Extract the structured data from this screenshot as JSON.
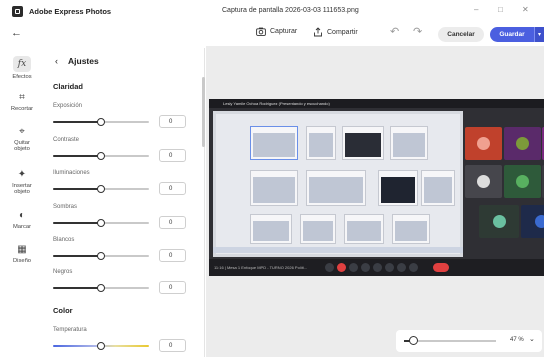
{
  "app": {
    "title": "Adobe Express Photos",
    "document_title": "Captura de pantalla 2026-03-03 111653.png"
  },
  "window_controls": {
    "minimize": "–",
    "maximize": "□",
    "close": "✕"
  },
  "toolbar": {
    "back_icon": "←",
    "capture_label": "Capturar",
    "share_label": "Compartir",
    "undo_icon": "↶",
    "redo_icon": "↷",
    "cancel_label": "Cancelar",
    "save_label": "Guardar",
    "save_more_icon": "▾"
  },
  "rail": {
    "items": [
      {
        "label": "Efectos",
        "icon": "fx"
      },
      {
        "label": "Recortar",
        "icon": "⌗"
      },
      {
        "label": "Quitar objeto",
        "icon": "⌖"
      },
      {
        "label": "Insertar objeto",
        "icon": "✦"
      },
      {
        "label": "Marcar",
        "icon": "◐"
      },
      {
        "label": "Diseño",
        "icon": "▦"
      }
    ]
  },
  "panel": {
    "back_icon": "‹",
    "title": "Ajustes",
    "sections": [
      {
        "title": "Claridad",
        "controls": [
          {
            "label": "Exposición",
            "value": "0",
            "level": 0.5
          },
          {
            "label": "Contraste",
            "value": "0",
            "level": 0.5
          },
          {
            "label": "Iluminaciones",
            "value": "0",
            "level": 0.5
          },
          {
            "label": "Sombras",
            "value": "0",
            "level": 0.5
          },
          {
            "label": "Blancos",
            "value": "0",
            "level": 0.5
          },
          {
            "label": "Negros",
            "value": "0",
            "level": 0.5
          }
        ]
      },
      {
        "title": "Color",
        "controls": [
          {
            "label": "Temperatura",
            "value": "0",
            "level": 0.5
          }
        ]
      }
    ]
  },
  "canvas": {
    "image_caption": "Lesly Yamile Ochoa Rodriguez (Presentando y escuchando)",
    "meeting_bottom_text": "11:16  |  Mesa 1 Enfoque MPD - TURNO 2026 Políti...",
    "zoom": {
      "value": "47 %",
      "level": 0.1,
      "chevron": "⌄"
    }
  },
  "colors": {
    "accent": "#4b5fe0",
    "canvas_bg": "#ececec"
  }
}
